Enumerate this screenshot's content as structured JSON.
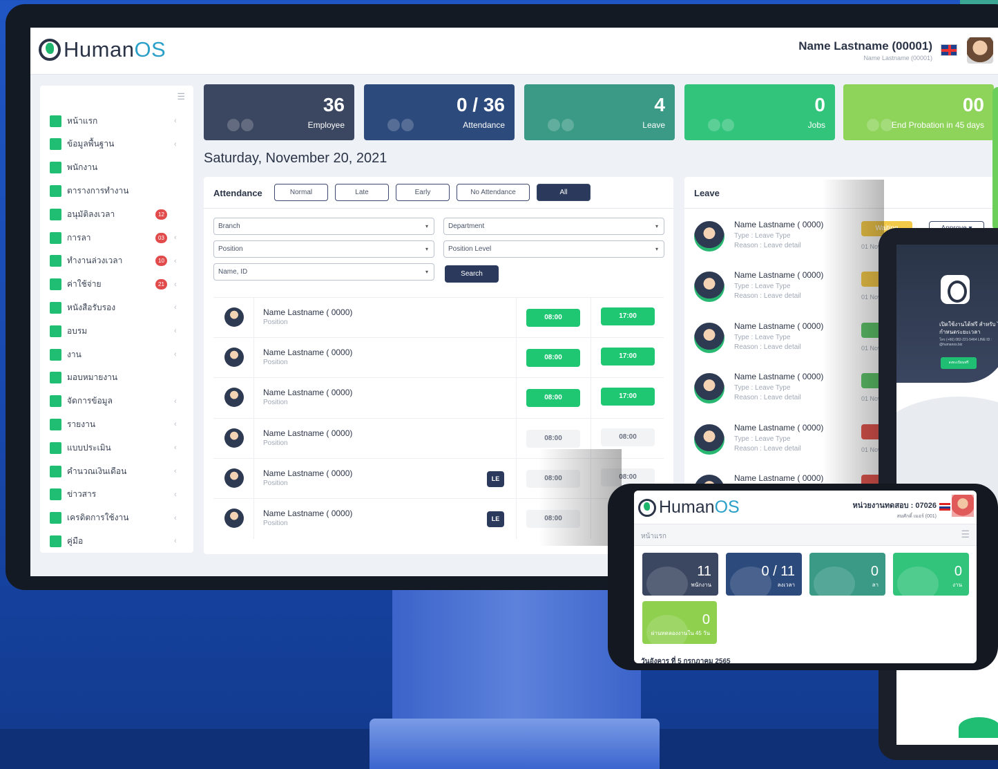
{
  "app": {
    "brand_name_1": "Human",
    "brand_name_2": "OS",
    "user_name": "Name Lastname (00001)",
    "user_sub": "Name Lastname (00001)",
    "language_flag": "uk-flag-icon"
  },
  "sidebar": {
    "menu_icon": "☰",
    "items": [
      {
        "label": "หน้าแรก",
        "badge": "",
        "chevron": "‹"
      },
      {
        "label": "ข้อมูลพื้นฐาน",
        "badge": "",
        "chevron": "‹"
      },
      {
        "label": "พนักงาน",
        "badge": "",
        "chevron": ""
      },
      {
        "label": "ตารางการทำงาน",
        "badge": "",
        "chevron": ""
      },
      {
        "label": "อนุมัติลงเวลา",
        "badge": "12",
        "chevron": ""
      },
      {
        "label": "การลา",
        "badge": "03",
        "chevron": "‹"
      },
      {
        "label": "ทำงานล่วงเวลา",
        "badge": "10",
        "chevron": "‹"
      },
      {
        "label": "ค่าใช้จ่าย",
        "badge": "21",
        "chevron": "‹"
      },
      {
        "label": "หนังสือรับรอง",
        "badge": "",
        "chevron": "‹"
      },
      {
        "label": "อบรม",
        "badge": "",
        "chevron": "‹"
      },
      {
        "label": "งาน",
        "badge": "",
        "chevron": "‹"
      },
      {
        "label": "มอบหมายงาน",
        "badge": "",
        "chevron": ""
      },
      {
        "label": "จัดการข้อมูล",
        "badge": "",
        "chevron": "‹"
      },
      {
        "label": "รายงาน",
        "badge": "",
        "chevron": "‹"
      },
      {
        "label": "แบบประเมิน",
        "badge": "",
        "chevron": "‹"
      },
      {
        "label": "คำนวณเงินเดือน",
        "badge": "",
        "chevron": "‹"
      },
      {
        "label": "ข่าวสาร",
        "badge": "",
        "chevron": "‹"
      },
      {
        "label": "เครดิตการใช้งาน",
        "badge": "",
        "chevron": "‹"
      },
      {
        "label": "คู่มือ",
        "badge": "",
        "chevron": "‹"
      }
    ]
  },
  "stats": [
    {
      "value": "36",
      "label": "Employee",
      "color": "#3b4660"
    },
    {
      "value": "0 / 36",
      "label": "Attendance",
      "color": "#2c4a7c"
    },
    {
      "value": "4",
      "label": "Leave",
      "color": "#3a9a86"
    },
    {
      "value": "0",
      "label": "Jobs",
      "color": "#33c47c"
    },
    {
      "value": "00",
      "label": "End Probation in 45 days",
      "color": "#8ed35a"
    }
  ],
  "date_title": "Saturday, November 20, 2021",
  "attendance": {
    "title": "Attendance",
    "filters": [
      "Normal",
      "Late",
      "Early",
      "No Attendance",
      "All"
    ],
    "active_filter": "All",
    "selects": {
      "branch": "Branch",
      "department": "Department",
      "position": "Position",
      "position_level": "Position Level",
      "name_id": "Name, ID"
    },
    "search_label": "Search",
    "rows": [
      {
        "name": "Name Lastname ( 0000)",
        "position": "Position",
        "badge": "",
        "in": "08:00",
        "out": "17:00",
        "status": "ok"
      },
      {
        "name": "Name Lastname ( 0000)",
        "position": "Position",
        "badge": "",
        "in": "08:00",
        "out": "17:00",
        "status": "ok"
      },
      {
        "name": "Name Lastname ( 0000)",
        "position": "Position",
        "badge": "",
        "in": "08:00",
        "out": "17:00",
        "status": "ok"
      },
      {
        "name": "Name Lastname ( 0000)",
        "position": "Position",
        "badge": "",
        "in": "08:00",
        "out": "08:00",
        "status": "none"
      },
      {
        "name": "Name Lastname ( 0000)",
        "position": "Position",
        "badge": "LE",
        "in": "08:00",
        "out": "08:00",
        "status": "none"
      },
      {
        "name": "Name Lastname ( 0000)",
        "position": "Position",
        "badge": "LE",
        "in": "08:00",
        "out": "",
        "status": "none"
      }
    ]
  },
  "leave": {
    "title": "Leave",
    "items": [
      {
        "name": "Name Lastname ( 0000)",
        "type": "Type : Leave Type",
        "reason": "Reason : Leave detail",
        "date": "01 Nov",
        "status": "Waiting",
        "status_color": "#f3c94a",
        "action": "Approve ▾"
      },
      {
        "name": "Name Lastname ( 0000)",
        "type": "Type : Leave Type",
        "reason": "Reason : Leave detail",
        "date": "01 Nov",
        "status": "Wa",
        "status_color": "#f3c94a",
        "action": ""
      },
      {
        "name": "Name Lastname ( 0000)",
        "type": "Type : Leave Type",
        "reason": "Reason : Leave detail",
        "date": "01 Nov",
        "status": "App",
        "status_color": "#5fc46a",
        "action": ""
      },
      {
        "name": "Name Lastname ( 0000)",
        "type": "Type : Leave Type",
        "reason": "Reason : Leave detail",
        "date": "01 Nov",
        "status": "App",
        "status_color": "#5fc46a",
        "action": ""
      },
      {
        "name": "Name Lastname ( 0000)",
        "type": "Type : Leave Type",
        "reason": "Reason : Leave detail",
        "date": "01 Nov",
        "status": "Rej",
        "status_color": "#e0554f",
        "action": ""
      },
      {
        "name": "Name Lastname ( 0000)",
        "type": "",
        "reason": "",
        "date": "",
        "status": "Rej",
        "status_color": "#e0554f",
        "action": ""
      }
    ]
  },
  "tablet": {
    "headline": "เปิดใช้งานได้ฟรี สำหรับ ไม่กำหนดระยะเวลา",
    "contact": "โทร (+66) 082-221-5464 LINE ID : @humanos.biz",
    "button": "ลงทะเบียนฟรี"
  },
  "phone": {
    "brand_name_1": "Human",
    "brand_name_2": "OS",
    "user_name": "หน่วยงานทดสอบ : 07026",
    "user_sub": "สมศักดิ์ เมอร์ (001)",
    "breadcrumb": "หน้าแรก",
    "menu_icon": "☰",
    "stats": [
      {
        "value": "11",
        "label": "พนักงาน",
        "color": "#3b4660"
      },
      {
        "value": "0 / 11",
        "label": "ลงเวลา",
        "color": "#2c4a7c"
      },
      {
        "value": "0",
        "label": "ลา",
        "color": "#3a9a86"
      },
      {
        "value": "0",
        "label": "งาน",
        "color": "#33c47c"
      }
    ],
    "stat_probation": {
      "value": "0",
      "label": "ผ่านทดลองงานใน 45 วัน"
    },
    "bottom_date": "วันอังคาร ที่ 5 กรกฎาคม 2565"
  }
}
